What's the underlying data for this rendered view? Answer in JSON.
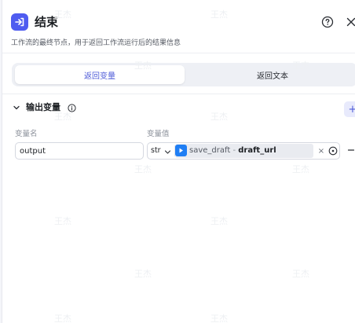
{
  "header": {
    "title": "结束",
    "description": "工作流的最终节点，用于返回工作流运行后的结果信息",
    "node_icon": "end-node-icon",
    "help_icon": "help-circle-icon",
    "close_icon": "close-icon"
  },
  "tabs": [
    {
      "label": "返回变量",
      "active": true
    },
    {
      "label": "返回文本",
      "active": false
    }
  ],
  "output_section": {
    "title": "输出变量",
    "info_icon": "info-icon",
    "add_label": "+",
    "columns": {
      "name": "变量名",
      "value": "变量值"
    },
    "rows": [
      {
        "name": "output",
        "type": "str",
        "ref_node": "save_draft",
        "ref_separator": " - ",
        "ref_field": "draft_url",
        "clear_label": "×",
        "remove_label": "−"
      }
    ]
  },
  "watermark_text": "王杰",
  "colors": {
    "accent": "#4f5cf0",
    "active_tab_text": "#4e5bd8",
    "ref_icon": "#1f7ef4",
    "background": "#f4f5f9"
  }
}
